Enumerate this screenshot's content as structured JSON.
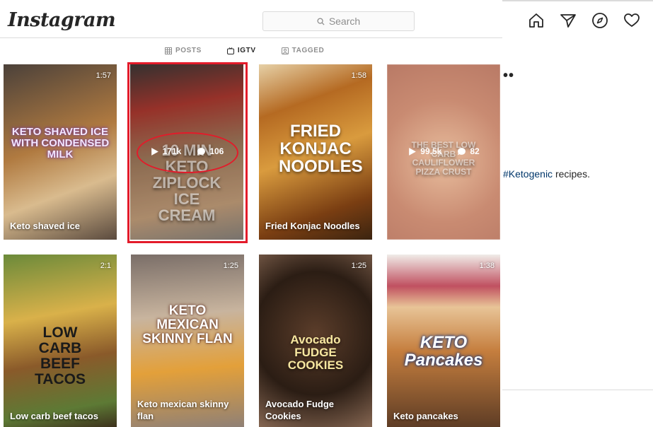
{
  "header": {
    "logo": "Instagram",
    "search_placeholder": "Search"
  },
  "nav_icons": [
    "home-icon",
    "direct-icon",
    "explore-icon",
    "activity-heart-icon"
  ],
  "tabs": [
    {
      "label": "POSTS",
      "icon": "grid-icon",
      "active": false
    },
    {
      "label": "IGTV",
      "icon": "igtv-icon",
      "active": true
    },
    {
      "label": "TAGGED",
      "icon": "tagged-icon",
      "active": false
    }
  ],
  "right_panel": {
    "dots": "••",
    "hashtag": "#Ketogenic",
    "text": " recipes."
  },
  "videos": [
    {
      "overlay": "KETO SHAVED ICE WITH CONDENSED MILK",
      "duration": "1:57",
      "caption": "Keto shaved ice",
      "colors": [
        "#3a3230",
        "#b07a40",
        "#d7b98c"
      ]
    },
    {
      "overlay": "10 MIN KETO ZIPLOCK ICE CREAM",
      "duration": "",
      "caption": "",
      "views": "171k",
      "comments": "106",
      "colors": [
        "#6b6561",
        "#a47d5e",
        "#c9a37e"
      ]
    },
    {
      "overlay": "FRIED KONJAC NOODLES",
      "duration": "1:58",
      "caption": "Fried Konjac Noodles",
      "colors": [
        "#3b2410",
        "#b56a22",
        "#d99b3e"
      ]
    },
    {
      "overlay": "THE BEST LOW CARB CAULIFLOWER PIZZA CRUST",
      "duration": "",
      "caption": "",
      "views": "99.5k",
      "comments": "82",
      "colors": [
        "#c08b78",
        "#e0b39a",
        "#d8a08a"
      ]
    },
    {
      "overlay": "LOW CARB BEEF TACOS",
      "duration": "2:1",
      "caption": "Low carb beef tacos",
      "colors": [
        "#7a5a30",
        "#d9b14a",
        "#5d7a35"
      ]
    },
    {
      "overlay": "KETO MEXICAN SKINNY FLAN",
      "duration": "1:25",
      "caption": "Keto mexican skinny flan",
      "colors": [
        "#8c7f78",
        "#c8b49e",
        "#e3a03a"
      ]
    },
    {
      "overlay": "Avocado FUDGE COOKIES",
      "duration": "1:25",
      "caption": "Avocado Fudge Cookies",
      "colors": [
        "#2b1d14",
        "#5b3d2a",
        "#8a6a55"
      ]
    },
    {
      "overlay": "KETO Pancakes",
      "duration": "1:38",
      "caption": "Keto pancakes",
      "colors": [
        "#5a3a24",
        "#c57e3e",
        "#e8c497"
      ]
    }
  ]
}
